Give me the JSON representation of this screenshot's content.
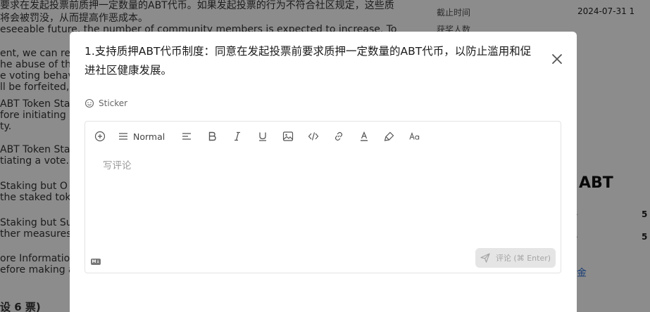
{
  "background": {
    "text_lines": [
      "要求在发起投票前质押一定数量的ABT代币。如果发起投票的行为不符合社区规定，这些质",
      "将会被罚没，从而提高作恶成本。",
      "eseeable future, the number of community members is expected to increase. To",
      "ent, we can rec",
      "he abuse of the",
      "e voting behav",
      "ll be forfeited,",
      "ABT Token Sta",
      "fore initiating a",
      "ty.",
      "ABT Token Sta",
      "tiating a vote.",
      "Staking but O",
      "the staked tok",
      "Staking but Su",
      "ther measures",
      "ore Information",
      "efore making a",
      "设 6 票)"
    ],
    "right_panel": {
      "deadline_label": "截止时间",
      "deadline_value": "2024-07-31 1",
      "winners_label": "获奖人数",
      "amount": "0 ABT",
      "row1_value": "5",
      "row2_value": "5",
      "link_text": "金"
    }
  },
  "modal": {
    "title": "1.支持质押ABT代币制度：同意在发起投票前要求质押一定数量的ABT代币，以防止滥用和促进社区健康发展。",
    "close_icon": "close-icon",
    "sticker_label": "Sticker",
    "editor": {
      "paragraph_style": "Normal",
      "placeholder": "写评论",
      "markdown_badge": "M↓",
      "submit_label": "评论 (⌘ Enter)"
    }
  }
}
